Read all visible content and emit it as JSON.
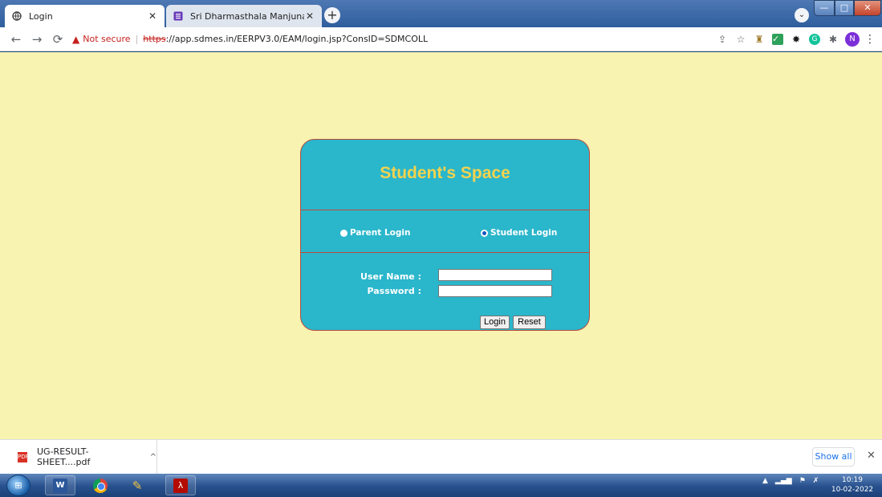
{
  "browser": {
    "tabs": [
      {
        "title": "Login",
        "active": true
      },
      {
        "title": "Sri Dharmasthala Manjunathesh",
        "active": false
      }
    ],
    "new_tab_label": "+",
    "url": {
      "warning_text": "Not secure",
      "separator": "|",
      "scheme": "https",
      "rest": "://app.sdmes.in/EERPV3.0/EAM/login.jsp?ConsID=SDMCOLL"
    },
    "profile_initial": "N"
  },
  "page": {
    "background_color": "#f8f3b0",
    "card_color": "#2ab6cb",
    "title": "Student's Space",
    "parent_login_label": "Parent Login",
    "student_login_label": "Student Login",
    "selected_login": "student",
    "username_label": "User Name :",
    "password_label": "Password :",
    "username_value": "",
    "password_value": "",
    "login_button_label": "Login",
    "reset_button_label": "Reset"
  },
  "downloads": {
    "file_name": "UG-RESULT-SHEET....pdf",
    "show_all_label": "Show all"
  },
  "taskbar": {
    "time": "10:19",
    "date": "10-02-2022"
  }
}
